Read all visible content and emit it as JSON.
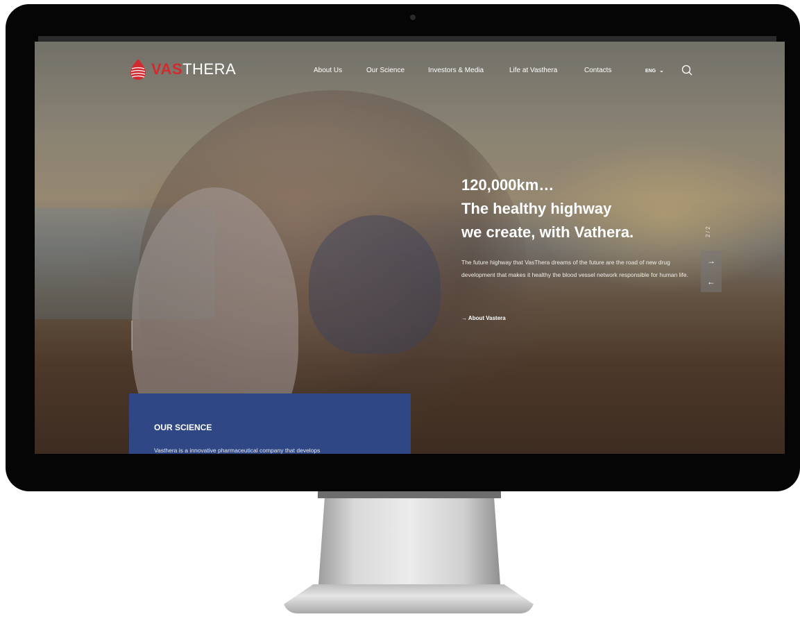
{
  "brand": {
    "name_part1": "VAS",
    "name_part2": "THERA",
    "accent_color": "#d22a2f",
    "card_color": "#2f4784"
  },
  "nav": {
    "items": [
      {
        "label": "About Us"
      },
      {
        "label": "Our Science"
      },
      {
        "label": "Investors & Media"
      },
      {
        "label": "Life at Vasthera"
      },
      {
        "label": "Contacts"
      }
    ],
    "language": "ENG",
    "language_icon": "chevron-down-icon",
    "search_icon": "search-icon"
  },
  "hero": {
    "headline_lines": [
      "120,000km…",
      "The healthy highway",
      "we create, with Vathera."
    ],
    "description": "The future highway that VasThera dreams of the future are the road of new drug development that makes it healthy the blood vessel network responsible for human life.",
    "cta_label": "→ About Vastera",
    "slide_counter": "2 / 2",
    "next_icon": "arrow-right-icon",
    "prev_icon": "arrow-left-icon"
  },
  "science_card": {
    "title": "OUR SCIENCE",
    "text": "Vasthera is a innovative pharmaceutical company that develops"
  }
}
